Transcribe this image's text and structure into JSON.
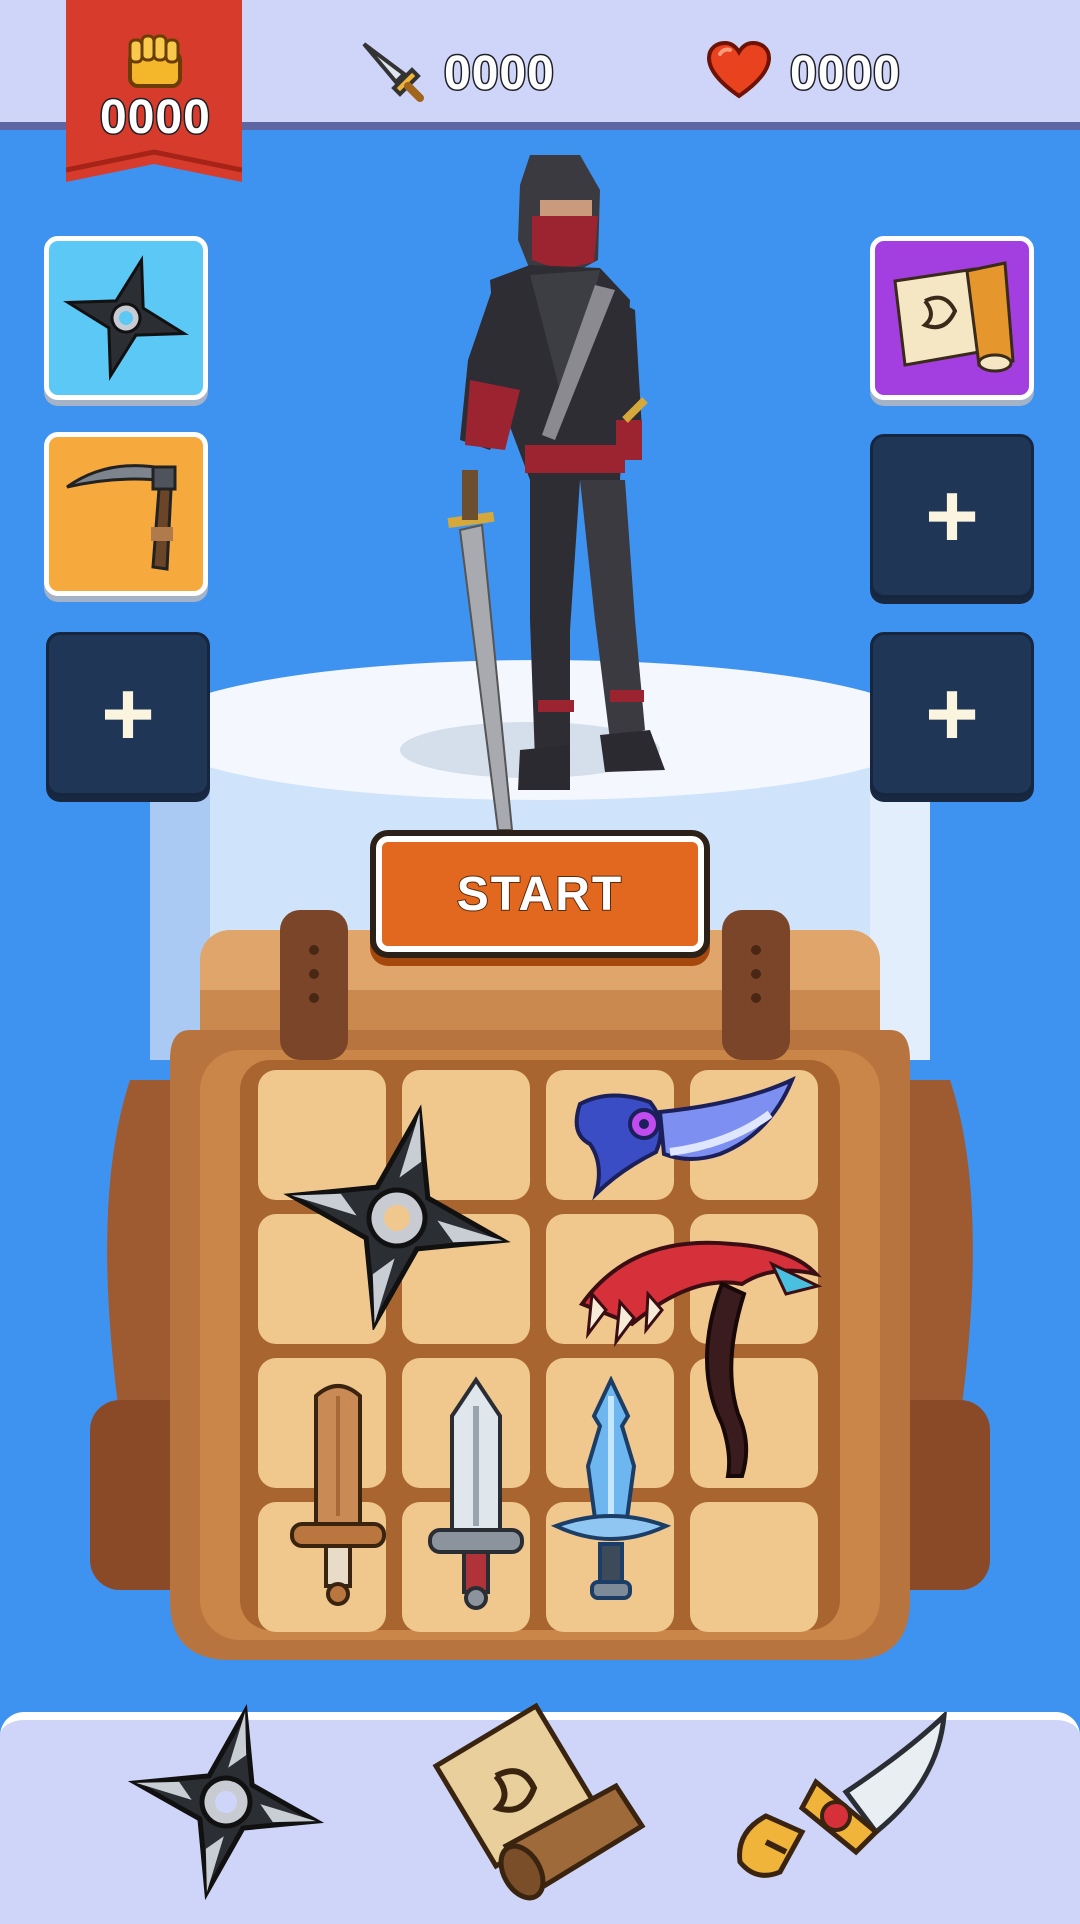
{
  "hud": {
    "power": {
      "icon": "fist-icon",
      "value": "0000"
    },
    "attack": {
      "icon": "sword-icon",
      "value": "0000"
    },
    "health": {
      "icon": "heart-icon",
      "value": "0000"
    }
  },
  "left_slots": [
    {
      "icon": "shuriken-icon",
      "color": "#5cc8f6"
    },
    {
      "icon": "kama-sickle-icon",
      "color": "#f6a93c"
    },
    {
      "icon": "plus-icon",
      "label": "+"
    }
  ],
  "right_slots": [
    {
      "icon": "scroll-icon",
      "color": "#a33ee0"
    },
    {
      "icon": "plus-icon",
      "label": "+"
    },
    {
      "icon": "plus-icon",
      "label": "+"
    }
  ],
  "start_button": {
    "label": "START"
  },
  "backpack": {
    "items": [
      "shuriken-icon",
      "dragon-dagger-icon",
      "demon-scythe-icon",
      "wooden-sword-icon",
      "steel-sword-icon",
      "crystal-sword-icon"
    ]
  },
  "bottom_nav": [
    {
      "icon": "shuriken-icon"
    },
    {
      "icon": "scroll-icon"
    },
    {
      "icon": "golden-dagger-icon"
    }
  ],
  "colors": {
    "background": "#3f93f0",
    "bar": "#cfd5f8",
    "ribbon": "#d73b2c",
    "start": "#e2681f",
    "backpack": "#b8743f"
  }
}
